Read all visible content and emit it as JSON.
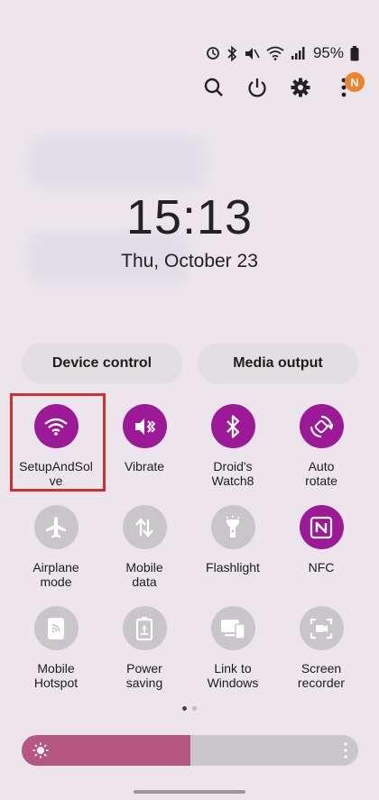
{
  "status_bar": {
    "battery": "95%",
    "icons": [
      "data-saver-icon",
      "bluetooth-icon",
      "mute-icon",
      "wifi-icon",
      "signal-icon",
      "battery-icon"
    ]
  },
  "top_actions": {
    "notification_badge": "N",
    "icons": [
      "search-icon",
      "power-icon",
      "gear-icon",
      "more-vertical-icon"
    ]
  },
  "clock": {
    "time": "15:13",
    "date": "Thu, October 23"
  },
  "pills": {
    "device_control": "Device control",
    "media_output": "Media output"
  },
  "tiles": [
    {
      "id": "wifi",
      "label_line1": "SetupAndSol",
      "label_line2": "ve",
      "state": "on",
      "icon": "wifi-icon"
    },
    {
      "id": "vibrate",
      "label_line1": "Vibrate",
      "label_line2": "",
      "state": "on",
      "icon": "vibrate-icon"
    },
    {
      "id": "bluetooth",
      "label_line1": "Droid's",
      "label_line2": "Watch8",
      "state": "on",
      "icon": "bluetooth-icon"
    },
    {
      "id": "auto-rotate",
      "label_line1": "Auto",
      "label_line2": "rotate",
      "state": "on",
      "icon": "rotate-icon"
    },
    {
      "id": "airplane",
      "label_line1": "Airplane",
      "label_line2": "mode",
      "state": "off",
      "icon": "airplane-icon"
    },
    {
      "id": "mobile-data",
      "label_line1": "Mobile",
      "label_line2": "data",
      "state": "off",
      "icon": "data-arrows-icon"
    },
    {
      "id": "flashlight",
      "label_line1": "Flashlight",
      "label_line2": "",
      "state": "off",
      "icon": "flashlight-icon"
    },
    {
      "id": "nfc",
      "label_line1": "NFC",
      "label_line2": "",
      "state": "on",
      "icon": "nfc-icon"
    },
    {
      "id": "hotspot",
      "label_line1": "Mobile",
      "label_line2": "Hotspot",
      "state": "off",
      "icon": "hotspot-icon"
    },
    {
      "id": "power-saving",
      "label_line1": "Power",
      "label_line2": "saving",
      "state": "off",
      "icon": "battery-saver-icon"
    },
    {
      "id": "link-windows",
      "label_line1": "Link to",
      "label_line2": "Windows",
      "state": "off",
      "icon": "link-windows-icon"
    },
    {
      "id": "screen-recorder",
      "label_line1": "Screen",
      "label_line2": "recorder",
      "state": "off",
      "icon": "screen-recorder-icon"
    }
  ],
  "page_indicator": {
    "pages": 2,
    "active": 0
  },
  "brightness": {
    "level": 0.5
  },
  "colors": {
    "active_tile": "#9c1a97",
    "inactive_tile": "#c9c6c9",
    "brightness_fill": "#b65683",
    "highlight_box": "#d32f2f",
    "badge": "#f1822a"
  }
}
